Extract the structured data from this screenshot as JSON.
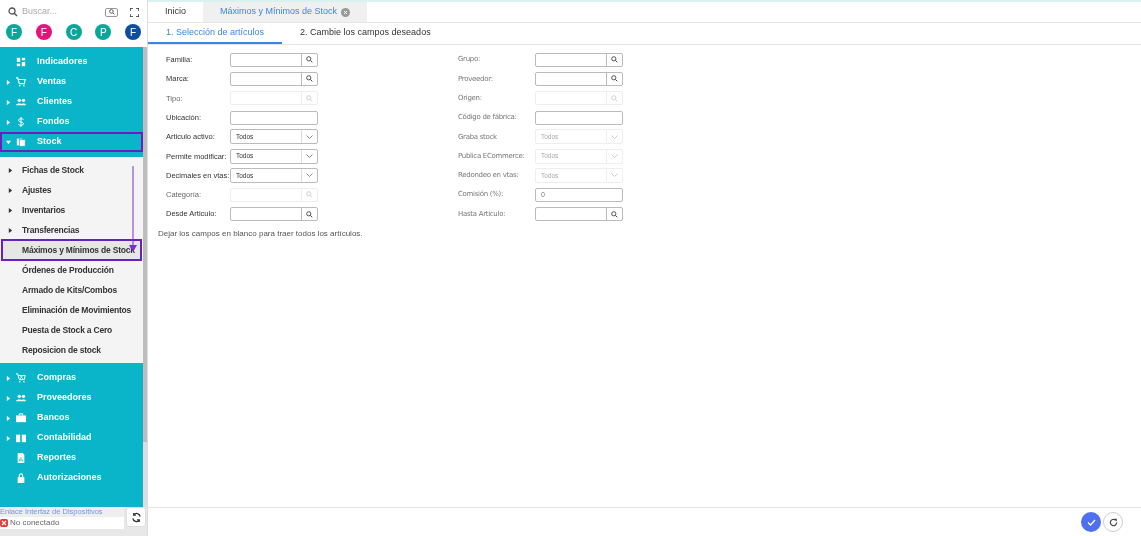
{
  "search": {
    "placeholder": "Buscar..."
  },
  "avatars": [
    {
      "letter": "F",
      "color": "#0aa69c"
    },
    {
      "letter": "F",
      "color": "#e4147b"
    },
    {
      "letter": "C",
      "color": "#0aa69c"
    },
    {
      "letter": "P",
      "color": "#0aa69c"
    },
    {
      "letter": "F",
      "color": "#0d4f9e"
    }
  ],
  "sidebar": {
    "items": [
      {
        "label": "Indicadores",
        "has_children": false,
        "expanded": false,
        "highlighted": false
      },
      {
        "label": "Ventas",
        "has_children": true,
        "expanded": false,
        "highlighted": false
      },
      {
        "label": "Clientes",
        "has_children": true,
        "expanded": false,
        "highlighted": false
      },
      {
        "label": "Fondos",
        "has_children": true,
        "expanded": false,
        "highlighted": false
      },
      {
        "label": "Stock",
        "has_children": true,
        "expanded": true,
        "highlighted": true,
        "children": [
          {
            "label": "Fichas de Stock",
            "has_children": true,
            "selected": false
          },
          {
            "label": "Ajustes",
            "has_children": true,
            "selected": false
          },
          {
            "label": "Inventarios",
            "has_children": true,
            "selected": false
          },
          {
            "label": "Transferencias",
            "has_children": true,
            "selected": false
          },
          {
            "label": "Máximos y Mínimos de Stock",
            "has_children": false,
            "selected": true
          },
          {
            "label": "Órdenes de Producción",
            "has_children": false,
            "selected": false
          },
          {
            "label": "Armado de Kits/Combos",
            "has_children": false,
            "selected": false
          },
          {
            "label": "Eliminación de Movimientos",
            "has_children": false,
            "selected": false
          },
          {
            "label": "Puesta de Stock a Cero",
            "has_children": false,
            "selected": false
          },
          {
            "label": "Reposicion de stock",
            "has_children": false,
            "selected": false
          }
        ]
      },
      {
        "label": "Compras",
        "has_children": true,
        "expanded": false,
        "highlighted": false
      },
      {
        "label": "Proveedores",
        "has_children": true,
        "expanded": false,
        "highlighted": false
      },
      {
        "label": "Bancos",
        "has_children": true,
        "expanded": false,
        "highlighted": false
      },
      {
        "label": "Contabilidad",
        "has_children": true,
        "expanded": false,
        "highlighted": false
      },
      {
        "label": "Reportes",
        "has_children": false,
        "expanded": false,
        "highlighted": false
      },
      {
        "label": "Autorizaciones",
        "has_children": false,
        "expanded": false,
        "highlighted": false
      }
    ]
  },
  "device_link": {
    "title": "Enlace Interfaz de Dispositivos",
    "status": "No conectado"
  },
  "tabs": [
    {
      "label": "Inicio",
      "selected": false,
      "closable": false
    },
    {
      "label": "Máximos y Mínimos de Stock",
      "selected": true,
      "closable": true
    }
  ],
  "steps": [
    {
      "label": "1. Selección de artículos",
      "selected": true
    },
    {
      "label": "2. Cambie los campos deseados",
      "selected": false
    }
  ],
  "form": {
    "left": [
      {
        "label": "Familia:",
        "kind": "search",
        "disabled": false
      },
      {
        "label": "Marca:",
        "kind": "search",
        "disabled": false
      },
      {
        "label": "Tipo:",
        "kind": "search",
        "disabled": true
      },
      {
        "label": "Ubicación:",
        "kind": "text",
        "disabled": false
      },
      {
        "label": "Articulo activo:",
        "kind": "select",
        "disabled": false,
        "value": "Todos"
      },
      {
        "label": "Permite modificar:",
        "kind": "select",
        "disabled": false,
        "value": "Todos"
      },
      {
        "label": "Decimales en vtas:",
        "kind": "select",
        "disabled": false,
        "value": "Todos"
      },
      {
        "label": "Categoría:",
        "kind": "search",
        "disabled": true
      },
      {
        "label": "Desde Articulo:",
        "kind": "search",
        "disabled": false
      }
    ],
    "right": [
      {
        "label": "Grupo:",
        "kind": "search",
        "disabled": false
      },
      {
        "label": "Proveedor:",
        "kind": "search",
        "disabled": false
      },
      {
        "label": "Origen:",
        "kind": "search",
        "disabled": true
      },
      {
        "label": "Código de fábrica:",
        "kind": "text",
        "disabled": false
      },
      {
        "label": "Graba stock",
        "kind": "select",
        "disabled": true,
        "value": "Todos"
      },
      {
        "label": "Publica ECommerce:",
        "kind": "select",
        "disabled": true,
        "value": "Todos"
      },
      {
        "label": "Redondeo en vtas:",
        "kind": "select",
        "disabled": true,
        "value": "Todos"
      },
      {
        "label": "Comisión (%):",
        "kind": "text",
        "disabled": false,
        "value": "0"
      },
      {
        "label": "Hasta Articulo:",
        "kind": "search",
        "disabled": false
      }
    ],
    "note": "Dejar los campos en blanco para traer todos los artículos."
  }
}
